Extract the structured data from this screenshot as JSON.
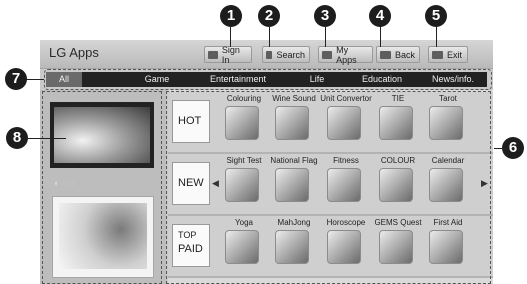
{
  "app_title": "LG Apps",
  "toolbar": {
    "sign_in": "Sign In",
    "search": "Search",
    "my_apps": "My Apps",
    "back": "Back",
    "exit": "Exit"
  },
  "tabs": [
    "All",
    "Game",
    "Entertainment",
    "Life",
    "Education",
    "News/info."
  ],
  "active_tab": "All",
  "callouts": [
    "1",
    "2",
    "3",
    "4",
    "5",
    "6",
    "7",
    "8"
  ],
  "rows": [
    {
      "label_lines": [
        "HOT"
      ],
      "apps": [
        "Colouring",
        "Wine Sound",
        "Unit Convertor",
        "TIE",
        "Tarot"
      ]
    },
    {
      "label_lines": [
        "NEW"
      ],
      "apps": [
        "Sight Test",
        "National Flag",
        "Fitness",
        "COLOUR",
        "Calendar"
      ]
    },
    {
      "label_lines": [
        "TOP",
        "PAID"
      ],
      "apps": [
        "Yoga",
        "MahJong",
        "Horoscope",
        "GEMS Quest",
        "First Aid"
      ]
    }
  ],
  "colors": {
    "callout": "#1d1d1d",
    "tab_bar": "#222222",
    "title_bar": "#c6c6c6"
  }
}
